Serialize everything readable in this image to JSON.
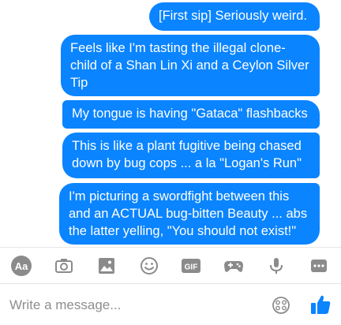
{
  "messages": [
    {
      "text": "[First sip] Seriously weird."
    },
    {
      "text": "Feels like I'm tasting the illegal clone-child of a Shan Lin Xi and a Ceylon Silver Tip"
    },
    {
      "text": "My tongue is having \"Gataca\" flashbacks"
    },
    {
      "text": "This is like a plant fugitive being chased down by bug cops ... a la \"Logan's Run\""
    },
    {
      "text": "I'm picturing a swordfight between this and an ACTUAL bug-bitten Beauty ... abs the latter yelling, \"You should not exist!\""
    }
  ],
  "toolbar": {
    "aa_label": "Aa",
    "gif_label": "GIF",
    "icons": [
      "text-style-icon",
      "camera-icon",
      "gallery-icon",
      "emoji-icon",
      "gif-icon",
      "gamepad-icon",
      "microphone-icon",
      "more-icon"
    ]
  },
  "composer": {
    "placeholder": "Write a message...",
    "icons": [
      "sticker-icon",
      "thumbs-up-icon"
    ]
  },
  "colors": {
    "bubble": "#0a84ff",
    "icon_grey": "#8b8b8b",
    "like_blue": "#0a84ff"
  }
}
